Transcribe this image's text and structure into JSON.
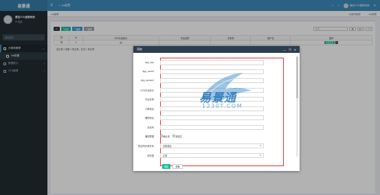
{
  "app": {
    "logo": "易景通",
    "user_name": "景区OTA直销系统",
    "user_status": "在线"
  },
  "sidebar": {
    "search_placeholder": "搜索菜单",
    "items": [
      {
        "label": "分销商管理",
        "active": true
      },
      {
        "label": "ota配置",
        "sub": true
      },
      {
        "label": "数据统计"
      },
      {
        "label": "OTA管理"
      }
    ]
  },
  "topbar": {
    "home_tab": "ota配置",
    "right_user": "景区OTA直销系统"
  },
  "breadcrumb": {
    "left": "ota配置",
    "right_items": [
      "分销商管理",
      "ota配置"
    ]
  },
  "toolbar": {
    "add": "添加",
    "edit": "编辑",
    "delete": "删除",
    "search_placeholder": "搜索",
    "refresh_icon": "refresh-icon"
  },
  "table": {
    "headers": [
      "",
      "Id",
      "OTA平台标示",
      "平台名称",
      "手机号",
      "用户名",
      "操作"
    ],
    "rows": [
      {
        "id": "1",
        "ota": "yy",
        "name": "",
        "phone": "",
        "user": "",
        "op": "景区配置"
      }
    ],
    "pager": "显示第 1 到第 1 条记录，总共 1 条记录"
  },
  "modal": {
    "title": "添加",
    "fields": [
      {
        "label": "App_key",
        "type": "input",
        "value": ""
      },
      {
        "label": "App_secret",
        "type": "input",
        "value": ""
      },
      {
        "label": "App_account",
        "type": "input",
        "value": ""
      },
      {
        "label": "OTA平台标示",
        "type": "input",
        "value": ""
      },
      {
        "label": "平台名称",
        "type": "input",
        "value": ""
      },
      {
        "label": "订单地址",
        "type": "input",
        "value": ""
      },
      {
        "label": "通知地址",
        "type": "input",
        "value": ""
      },
      {
        "label": "手机号",
        "type": "input",
        "value": ""
      },
      {
        "label": "通知票据",
        "type": "radio",
        "options": [
          "确认改",
          "拆成正"
        ]
      },
      {
        "label": "是否同步首关系",
        "type": "select",
        "value": "全部景区"
      },
      {
        "label": "状态值",
        "type": "select",
        "value": "正常"
      }
    ],
    "ok_button": "确定",
    "reset_button": "重置"
  },
  "watermark": {
    "text": "易景通",
    "subtext": "1230T.COM"
  },
  "colors": {
    "sidebar": "#222d32",
    "topbar": "#3c8dbc",
    "modal_header": "#2c3e50",
    "highlight_box": "#e03030",
    "primary": "#18bc9c"
  }
}
